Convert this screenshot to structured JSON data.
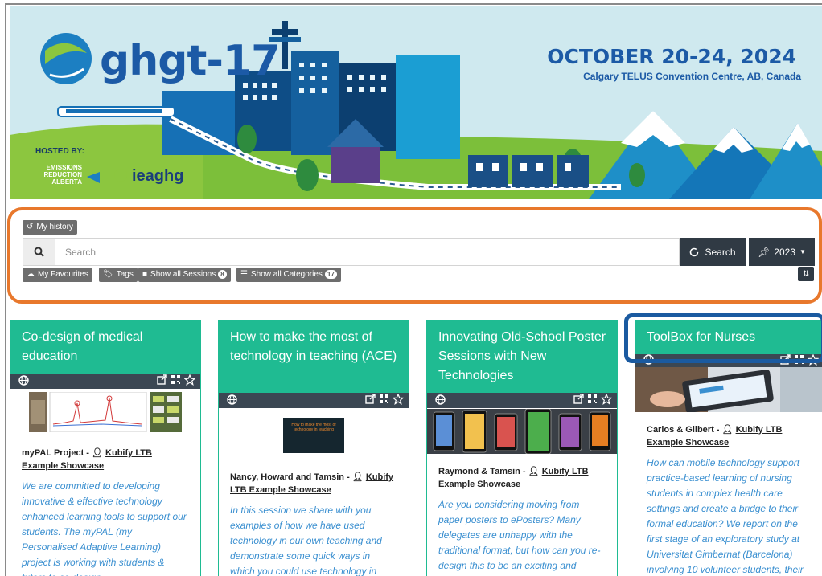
{
  "banner": {
    "brand_name": "ghgt-17",
    "event_date": "OCTOBER 20-24, 2024",
    "event_venue": "Calgary TELUS Convention Centre, AB, Canada",
    "hosted_by": "HOSTED BY:",
    "host_era": "EMISSIONS REDUCTION ALBERTA",
    "host_ieaghg": "ieaghg"
  },
  "toolbar": {
    "history_label": "My history",
    "search_placeholder": "Search",
    "search_button": "Search",
    "year_button": "2023",
    "favourites_label": "My Favourites",
    "tags_label": "Tags",
    "sessions_label": "Show all Sessions",
    "sessions_count": "8",
    "categories_label": "Show all Categories",
    "categories_count": "17"
  },
  "cards": [
    {
      "title": "Co-design of medical education",
      "authors": "myPAL Project - ",
      "showcase": "Kubify LTB Example Showcase",
      "description": "We are committed to developing innovative & effective technology enhanced learning tools to support our students. The myPAL (my Personalised Adaptive Learning) project is working with students & tutors to co-design"
    },
    {
      "title": "How to make the most of technology in teaching (ACE)",
      "thumb_text": "How to make the most of technology in teaching",
      "authors": "Nancy, Howard and Tamsin - ",
      "showcase": "Kubify LTB Example Showcase",
      "description": "In this session we share with you examples of how we have used technology in our own teaching and demonstrate some quick ways in which you could use technology in your own"
    },
    {
      "title": "Innovating Old-School Poster Sessions with New Technologies",
      "authors": "Raymond & Tamsin - ",
      "showcase": "Kubify LTB Example Showcase",
      "description": "Are you considering moving from paper posters to ePosters? Many delegates are unhappy with the traditional format, but how can you re-design this to be an exciting and educationally"
    },
    {
      "title": "ToolBox for Nurses",
      "authors": "Carlos & Gilbert - ",
      "showcase": "Kubify LTB Example Showcase",
      "description": "How can mobile technology support practice-based learning of nursing students in complex health care settings and create a bridge to their formal education? We report on the first stage of an exploratory study at Universitat Gimbernat (Barcelona) involving 10 volunteer students, their"
    }
  ],
  "icons": {
    "globe": "globe-icon",
    "external": "external-link-icon",
    "qr": "qr-code-icon",
    "star": "star-icon",
    "history": "history-icon",
    "cloud": "cloud-icon",
    "tag": "tag-icon",
    "file": "file-icon",
    "list": "list-icon",
    "pin": "pin-icon",
    "sort": "sort-icon",
    "user": "user-icon",
    "search": "search-icon"
  },
  "colors": {
    "teal": "#1fbb92",
    "dark_bar": "#3b4753",
    "button_dark": "#303a44",
    "orange_outline": "#e8782c",
    "blue_outline": "#1a5aa0",
    "description_blue": "#3a8fd0"
  }
}
